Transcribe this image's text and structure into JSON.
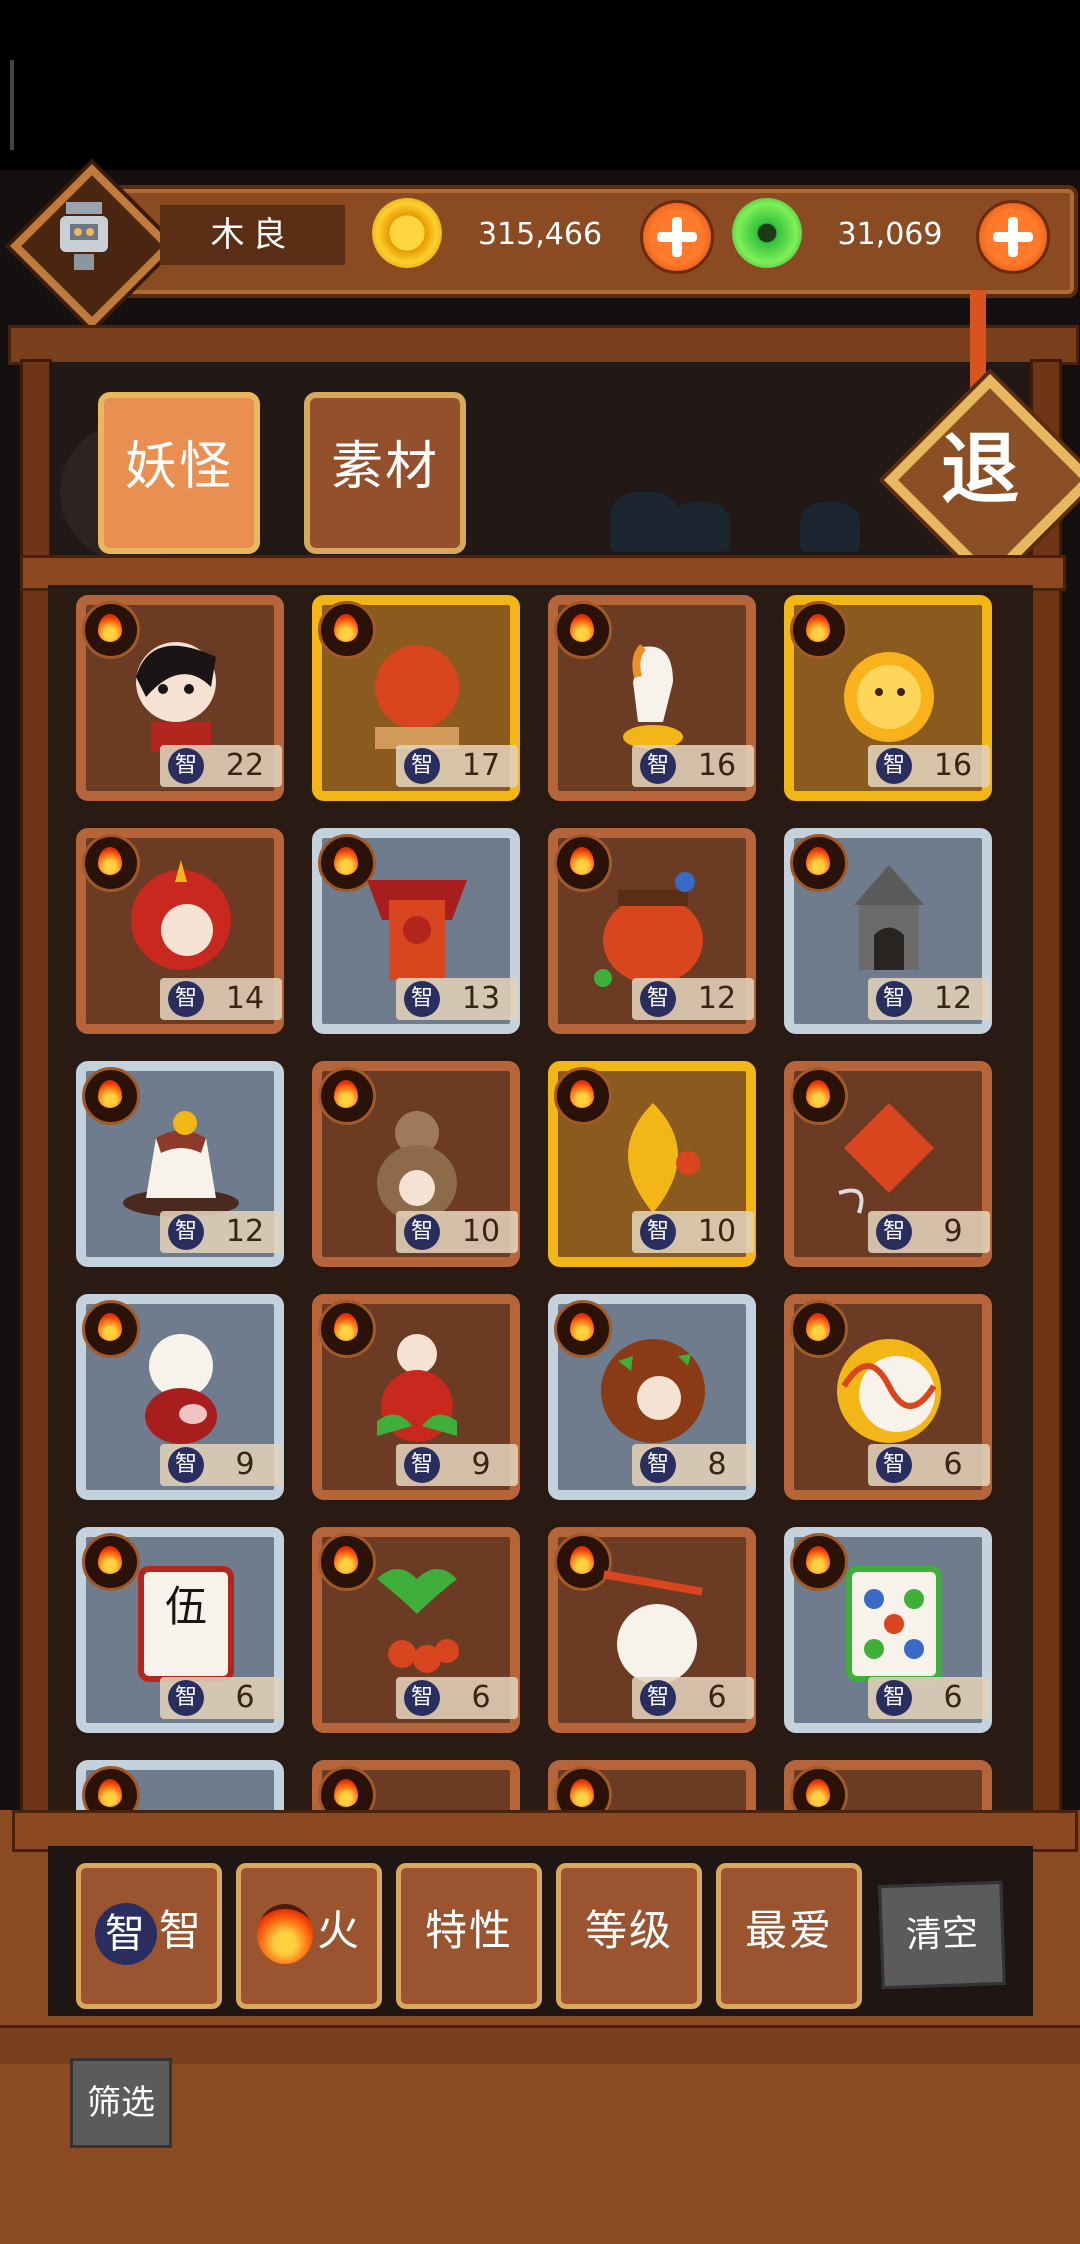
{
  "player": {
    "name": "木良"
  },
  "currency": {
    "gold": "315,466",
    "jade": "31,069"
  },
  "tabs": [
    {
      "label": "妖怪",
      "active": true
    },
    {
      "label": "素材",
      "active": false
    }
  ],
  "exit_label": "退",
  "stat_label": "智",
  "cards": [
    {
      "frame": "brown",
      "creature": "girl-warrior",
      "value": "22"
    },
    {
      "frame": "gold",
      "creature": "red-ball-on-stand",
      "value": "17"
    },
    {
      "frame": "brown",
      "creature": "white-horse",
      "value": "16"
    },
    {
      "frame": "gold",
      "creature": "golden-fruit",
      "value": "16"
    },
    {
      "frame": "brown",
      "creature": "red-haired-oni",
      "value": "14"
    },
    {
      "frame": "blue",
      "creature": "banner-mask",
      "value": "13"
    },
    {
      "frame": "brown",
      "creature": "red-pot",
      "value": "12"
    },
    {
      "frame": "blue",
      "creature": "stone-pagoda",
      "value": "12"
    },
    {
      "frame": "blue",
      "creature": "pudding",
      "value": "12"
    },
    {
      "frame": "brown",
      "creature": "gourd-spirit",
      "value": "10"
    },
    {
      "frame": "gold",
      "creature": "golden-leaf-bird",
      "value": "10"
    },
    {
      "frame": "brown",
      "creature": "red-kite",
      "value": "9"
    },
    {
      "frame": "blue",
      "creature": "mochi-pig",
      "value": "9"
    },
    {
      "frame": "brown",
      "creature": "rose-spirit",
      "value": "9"
    },
    {
      "frame": "blue",
      "creature": "meatball",
      "value": "8"
    },
    {
      "frame": "brown",
      "creature": "egg-swirl",
      "value": "6"
    },
    {
      "frame": "blue",
      "creature": "mahjong-wu",
      "value": "6"
    },
    {
      "frame": "brown",
      "creature": "berry-plant",
      "value": "6"
    },
    {
      "frame": "brown",
      "creature": "dumpling-chopsticks",
      "value": "6"
    },
    {
      "frame": "blue",
      "creature": "mahjong-dots",
      "value": "6"
    },
    {
      "frame": "blue",
      "creature": "partial",
      "value": ""
    },
    {
      "frame": "brown",
      "creature": "partial",
      "value": ""
    },
    {
      "frame": "brown",
      "creature": "partial",
      "value": ""
    },
    {
      "frame": "brown",
      "creature": "partial",
      "value": ""
    }
  ],
  "mahjong_char": "伍",
  "filters": [
    {
      "label": "智",
      "icon": "int"
    },
    {
      "label": "火",
      "icon": "fire"
    },
    {
      "label": "特性",
      "icon": ""
    },
    {
      "label": "等级",
      "icon": ""
    },
    {
      "label": "最爱",
      "icon": ""
    }
  ],
  "clear_label": "清空",
  "screen_label": "筛选",
  "colors": {
    "card_brown": "#b6653a",
    "card_blue": "#c4d2de",
    "card_gold": "#f2b616",
    "wood": "#8a4a22",
    "fire": "#ff6a10"
  }
}
